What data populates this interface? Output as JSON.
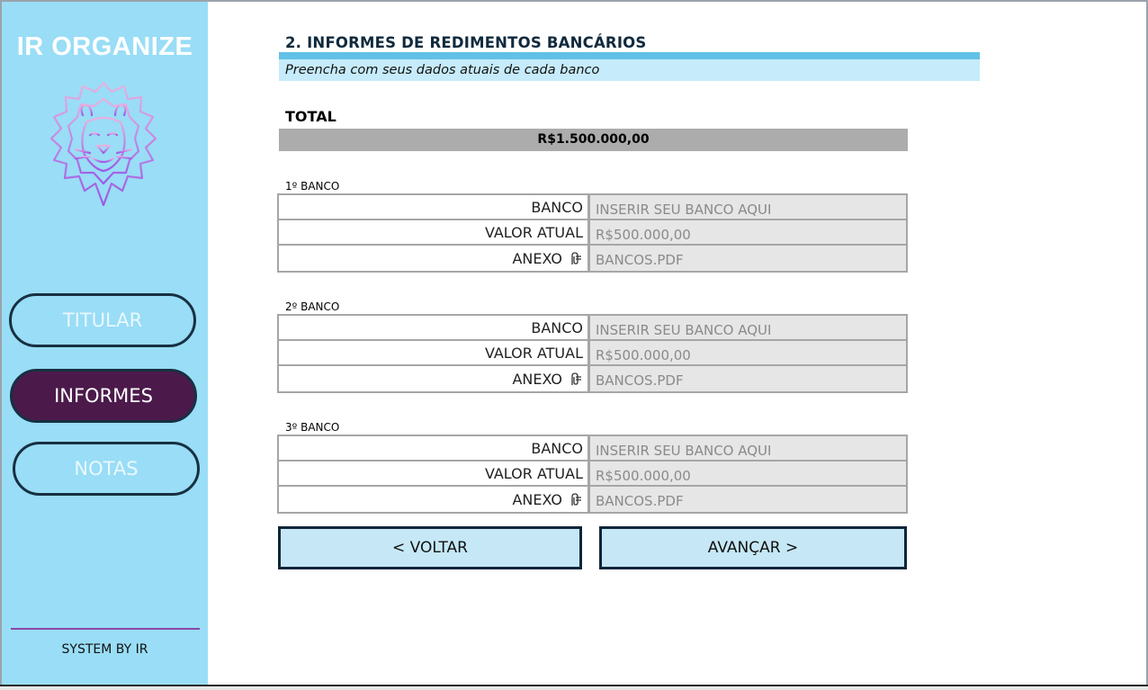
{
  "sidebar": {
    "brand": "IR ORGANIZE",
    "logo_icon": "lion-head-icon",
    "nav": [
      {
        "label": "TITULAR",
        "active": false
      },
      {
        "label": "INFORMES",
        "active": true
      },
      {
        "label": "NOTAS",
        "active": false
      }
    ],
    "footer": "SYSTEM BY IR"
  },
  "main": {
    "title": "2. INFORMES DE REDIMENTOS BANCÁRIOS",
    "subtitle": "Preencha com seus dados atuais de cada banco",
    "total_label": "TOTAL",
    "total_value": "R$1.500.000,00",
    "banks": [
      {
        "heading": "1º BANCO",
        "rows": [
          {
            "label": "BANCO",
            "value": "INSERIR SEU BANCO AQUI"
          },
          {
            "label": "VALOR ATUAL",
            "value": "R$500.000,00"
          },
          {
            "label": "ANEXO",
            "value": "BANCOS.PDF",
            "icon": "paperclip-icon"
          }
        ]
      },
      {
        "heading": "2º BANCO",
        "rows": [
          {
            "label": "BANCO",
            "value": "INSERIR SEU BANCO AQUI"
          },
          {
            "label": "VALOR ATUAL",
            "value": "R$500.000,00"
          },
          {
            "label": "ANEXO",
            "value": "BANCOS.PDF",
            "icon": "paperclip-icon"
          }
        ]
      },
      {
        "heading": "3º BANCO",
        "rows": [
          {
            "label": "BANCO",
            "value": "INSERIR SEU BANCO AQUI"
          },
          {
            "label": "VALOR ATUAL",
            "value": "R$500.000,00"
          },
          {
            "label": "ANEXO",
            "value": "BANCOS.PDF",
            "icon": "paperclip-icon"
          }
        ]
      }
    ],
    "buttons": {
      "back": "< VOLTAR",
      "next": "AVANÇAR >"
    }
  },
  "colors": {
    "sidebar_bg": "#99ddf6",
    "active_nav": "#4b1a4b",
    "title_bar": "#62c0e6",
    "subtitle_bg": "#c6ebfa",
    "total_bg": "#acacac",
    "button_bg": "#c6e8f6",
    "accent_line": "#8a47a8"
  }
}
